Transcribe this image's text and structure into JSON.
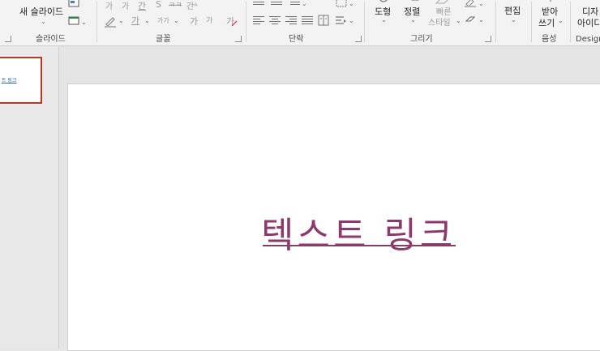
{
  "ribbon": {
    "slides_group": {
      "new_slide_label": "새 슬라이드",
      "group_label": "슬라이드"
    },
    "font_group": {
      "font_buttons": [
        "가",
        "가",
        "간",
        "S",
        "ㅋㅋ",
        "간ᴬ"
      ],
      "size_buttons": [
        "가",
        "가가",
        "가",
        "가"
      ],
      "group_label": "글꼴"
    },
    "paragraph_group": {
      "group_label": "단락"
    },
    "drawing_group": {
      "shapes_label": "도형",
      "arrange_label": "정렬",
      "quick_styles_line1": "빠른",
      "quick_styles_line2": "스타일",
      "group_label": "그리기"
    },
    "editing_group": {
      "editing_label": "편집"
    },
    "voice_group": {
      "dictate_line1": "받아",
      "dictate_line2": "쓰기",
      "group_label": "음성"
    },
    "designer_group": {
      "designer_line1": "디자",
      "designer_line2": "아이디",
      "group_label": "Design"
    }
  },
  "thumbnail": {
    "text": "트 링크"
  },
  "slide": {
    "link_text": "텍스트 링크"
  },
  "colors": {
    "link": "#8b3a6a",
    "selection_border": "#b73a20",
    "ribbon_bg": "#f3f3f3"
  }
}
